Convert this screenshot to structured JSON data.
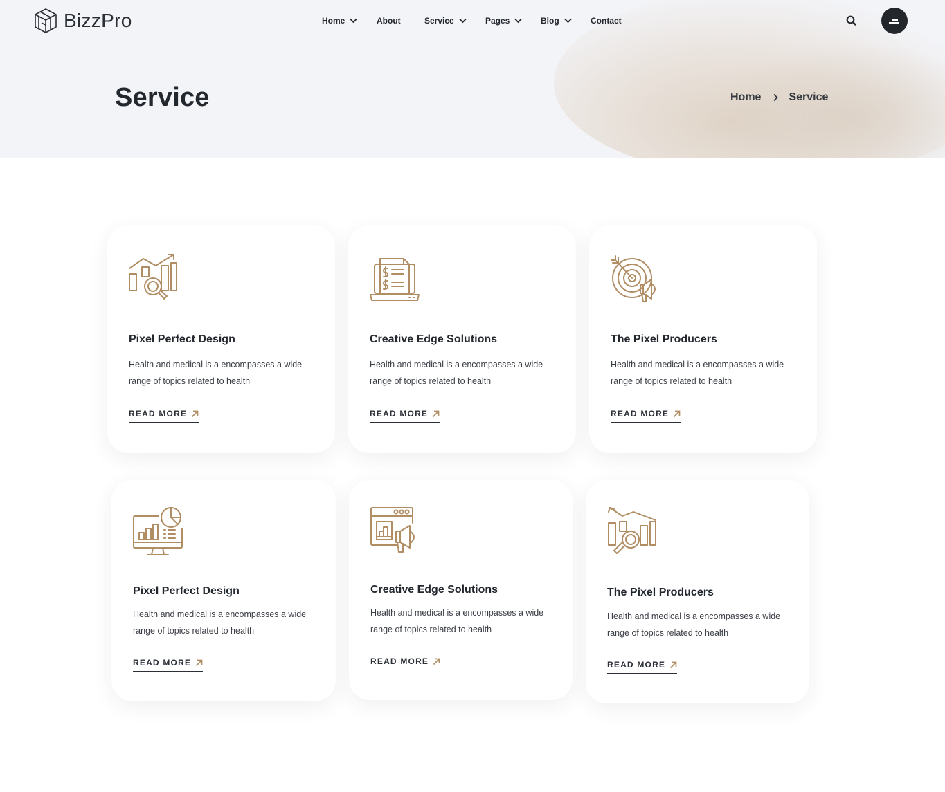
{
  "brand": {
    "name": "BizzPro",
    "accent": "#b08d63"
  },
  "nav": {
    "home": "Home",
    "about": "About",
    "service": "Service",
    "pages": "Pages",
    "blog": "Blog",
    "contact": "Contact"
  },
  "header": {
    "title": "Service",
    "breadcrumb": {
      "home": "Home",
      "current": "Service"
    }
  },
  "cards": [
    {
      "icon": "analytics-search-icon",
      "title": "Pixel Perfect Design",
      "desc": "Health and medical is a encompasses a wide range of topics related to health",
      "cta": "READ MORE"
    },
    {
      "icon": "laptop-invoice-icon",
      "title": "Creative Edge Solutions",
      "desc": "Health and medical is a encompasses a wide range of topics related to health",
      "cta": "READ MORE"
    },
    {
      "icon": "target-megaphone-icon",
      "title": "The Pixel Producers",
      "desc": "Health and medical is a encompasses a wide range of topics related to health",
      "cta": "READ MORE"
    },
    {
      "icon": "monitor-chart-icon",
      "title": "Pixel Perfect Design",
      "desc": "Health and medical is a encompasses a wide range of topics related to health",
      "cta": "READ MORE"
    },
    {
      "icon": "browser-megaphone-icon",
      "title": "Creative Edge Solutions",
      "desc": "Health and medical is a encompasses a wide range of topics related to health",
      "cta": "READ MORE"
    },
    {
      "icon": "chart-magnifier-icon",
      "title": "The Pixel Producers",
      "desc": "Health and medical is a encompasses a wide range of topics related to health",
      "cta": "READ MORE"
    }
  ]
}
